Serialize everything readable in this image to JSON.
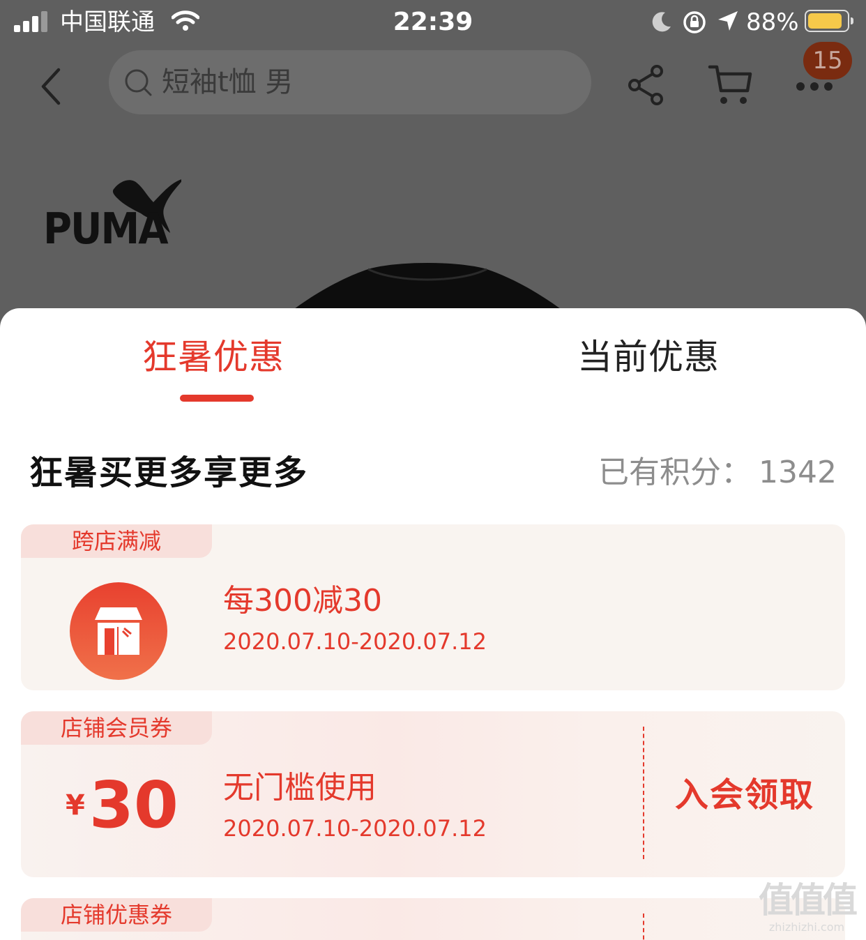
{
  "status_bar": {
    "carrier": "中国联通",
    "time": "22:39",
    "battery_percent": "88%",
    "battery_level": 0.88
  },
  "nav": {
    "search_text": "短袖t恤 男",
    "cart_badge": "15"
  },
  "product": {
    "brand_logo_text": "PUMA"
  },
  "sheet": {
    "tabs": [
      {
        "label": "狂暑优惠",
        "active": true
      },
      {
        "label": "当前优惠",
        "active": false
      }
    ],
    "section_title": "狂暑买更多享更多",
    "points_label": "已有积分：",
    "points_value": "1342",
    "cards": [
      {
        "tag": "跨店满减",
        "icon": "store-icon",
        "title": "每300减30",
        "date": "2020.07.10-2020.07.12"
      },
      {
        "tag": "店铺会员券",
        "currency": "¥",
        "amount": "30",
        "title": "无门槛使用",
        "date": "2020.07.10-2020.07.12",
        "action": "入会领取"
      },
      {
        "tag": "店铺优惠券"
      }
    ]
  },
  "watermark": {
    "text": "值值值",
    "url": "zhizhizhi.com"
  },
  "colors": {
    "accent": "#e4392c",
    "overlay": "#5f5f5f",
    "card_bg": "#f9f4f0",
    "tag_bg": "#f8dfdb"
  }
}
